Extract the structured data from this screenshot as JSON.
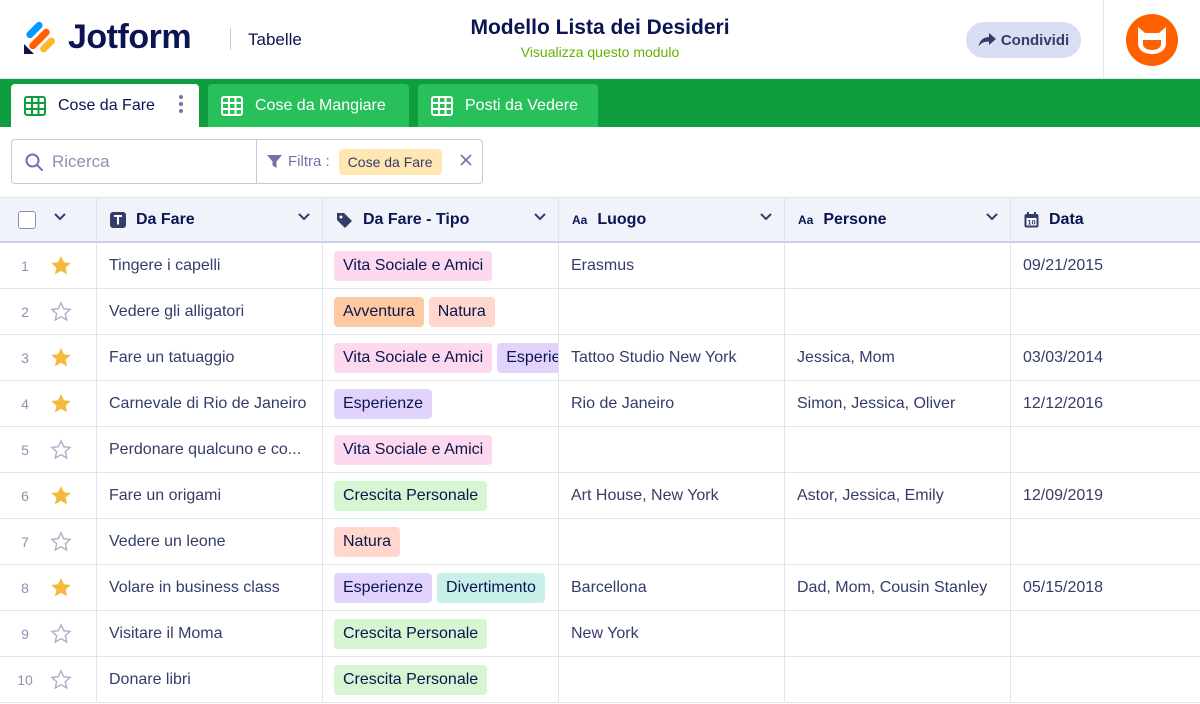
{
  "header": {
    "brand": "Jotform",
    "section": "Tabelle",
    "title": "Modello Lista dei Desideri",
    "subtitle": "Visualizza questo modulo",
    "share_label": "Condividi"
  },
  "tabs": [
    {
      "label": "Cose da Fare",
      "active": true
    },
    {
      "label": "Cose da Mangiare",
      "active": false
    },
    {
      "label": "Posti da Vedere",
      "active": false
    }
  ],
  "search": {
    "placeholder": "Ricerca"
  },
  "filter": {
    "label": "Filtra :",
    "value": "Cose da Fare"
  },
  "columns": {
    "fare": "Da Fare",
    "tipo": "Da Fare - Tipo",
    "luogo": "Luogo",
    "persone": "Persone",
    "data": "Data"
  },
  "tag_colors": {
    "Vita Sociale e Amici": "#fcd9ee",
    "Avventura": "#ffc9a1",
    "Natura": "#ffd7cd",
    "Esperienze": "#e1d3fb",
    "Crescita Personale": "#d6f5d1",
    "Divertimento": "#c8efe8"
  },
  "colors": {
    "brand_green": "#0f9e3f",
    "star_filled": "#f6b93b",
    "star_empty": "#aab0c9",
    "avatar": "#ff6100"
  },
  "rows": [
    {
      "num": "1",
      "starred": true,
      "fare": "Tingere i capelli",
      "tipo": [
        "Vita Sociale e Amici"
      ],
      "luogo": "Erasmus",
      "persone": "",
      "data": "09/21/2015"
    },
    {
      "num": "2",
      "starred": false,
      "fare": "Vedere gli alligatori",
      "tipo": [
        "Avventura",
        "Natura"
      ],
      "luogo": "",
      "persone": "",
      "data": ""
    },
    {
      "num": "3",
      "starred": true,
      "fare": "Fare un tatuaggio",
      "tipo": [
        "Vita Sociale e Amici",
        "Esperienze"
      ],
      "luogo": "Tattoo Studio New York",
      "persone": "Jessica, Mom",
      "data": "03/03/2014"
    },
    {
      "num": "4",
      "starred": true,
      "fare": "Carnevale di Rio de Janeiro",
      "tipo": [
        "Esperienze"
      ],
      "luogo": "Rio de Janeiro",
      "persone": "Simon, Jessica, Oliver",
      "data": "12/12/2016"
    },
    {
      "num": "5",
      "starred": false,
      "fare": "Perdonare qualcuno e co...",
      "tipo": [
        "Vita Sociale e Amici"
      ],
      "luogo": "",
      "persone": "",
      "data": ""
    },
    {
      "num": "6",
      "starred": true,
      "fare": "Fare un origami",
      "tipo": [
        "Crescita Personale"
      ],
      "luogo": "Art House, New York",
      "persone": "Astor, Jessica, Emily",
      "data": "12/09/2019"
    },
    {
      "num": "7",
      "starred": false,
      "fare": "Vedere un leone",
      "tipo": [
        "Natura"
      ],
      "luogo": "",
      "persone": "",
      "data": ""
    },
    {
      "num": "8",
      "starred": true,
      "fare": "Volare in business class",
      "tipo": [
        "Esperienze",
        "Divertimento"
      ],
      "luogo": "Barcellona",
      "persone": "Dad, Mom, Cousin Stanley",
      "data": "05/15/2018"
    },
    {
      "num": "9",
      "starred": false,
      "fare": "Visitare il Moma",
      "tipo": [
        "Crescita Personale"
      ],
      "luogo": "New York",
      "persone": "",
      "data": ""
    },
    {
      "num": "10",
      "starred": false,
      "fare": "Donare libri",
      "tipo": [
        "Crescita Personale"
      ],
      "luogo": "",
      "persone": "",
      "data": ""
    }
  ]
}
